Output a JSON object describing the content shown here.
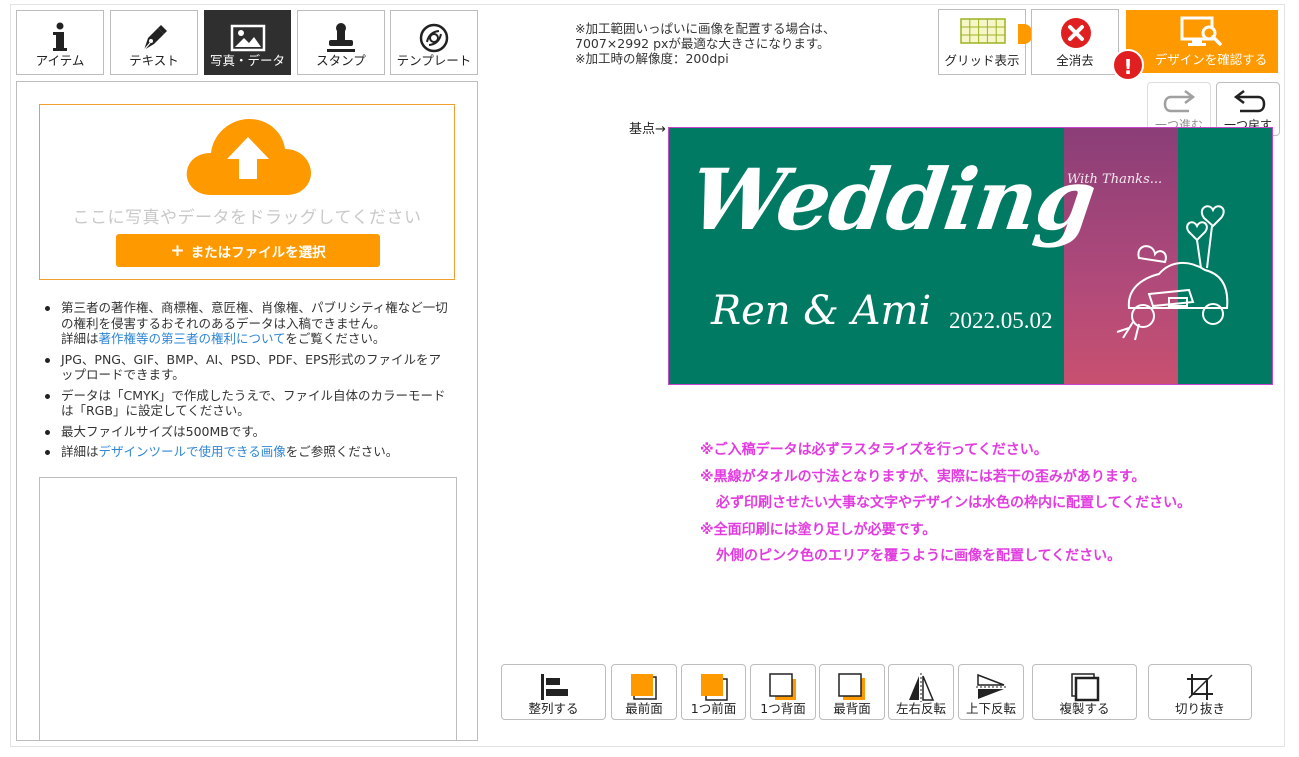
{
  "tabs": [
    {
      "label": "アイテム",
      "icon": "info-icon"
    },
    {
      "label": "テキスト",
      "icon": "pen-icon"
    },
    {
      "label": "写真・データ",
      "icon": "image-icon",
      "active": true
    },
    {
      "label": "スタンプ",
      "icon": "stamp-icon"
    },
    {
      "label": "テンプレート",
      "icon": "template-icon"
    }
  ],
  "upload": {
    "drop_text": "ここに写真やデータをドラッグしてください",
    "button_label": "またはファイルを選択",
    "notes": {
      "n1_text": "第三者の著作権、商標権、意匠権、肖像権、パブリシティ権など一切の権利を侵害するおそれのあるデータは入稿できません。",
      "n1_detail_prefix": "詳細は",
      "n1_link": "著作権等の第三者の権利について",
      "n1_suffix": "をご覧ください。",
      "n2": "JPG、PNG、GIF、BMP、AI、PSD、PDF、EPS形式のファイルをアップロードできます。",
      "n3": "データは「CMYK」で作成したうえで、ファイル自体のカラーモードは「RGB」に設定してください。",
      "n4": "最大ファイルサイズは500MBです。",
      "n5_prefix": "詳細は",
      "n5_link": "デザインツールで使用できる画像",
      "n5_suffix": "をご参照ください。"
    }
  },
  "header": {
    "info_line1": "※加工範囲いっぱいに画像を配置する場合は、",
    "info_line2": "7007×2992 pxが最適な大きさになります。",
    "info_line3": "※加工時の解像度：200dpi",
    "grid_label": "グリッド表示",
    "clear_label": "全消去",
    "confirm_label": "デザインを確認する",
    "alert": "!"
  },
  "history": {
    "redo_label": "一つ進む",
    "undo_label": "一つ戻す"
  },
  "canvas": {
    "origin_label": "基点→",
    "design": {
      "thanks": "With Thanks...",
      "title": "Wedding",
      "names": "Ren & Ami",
      "date": "2022.05.02"
    },
    "colors": {
      "background": "#007a62",
      "band": "#b04a7a",
      "outline": "#c844c8"
    }
  },
  "warnings": [
    "※ご入稿データは必ずラスタライズを行ってください。",
    "※黒線がタオルの寸法となりますが、実際には若干の歪みがあります。",
    "必ず印刷させたい大事な文字やデザインは水色の枠内に配置してください。",
    "※全面印刷には塗り足しが必要です。",
    "外側のピンク色のエリアを覆うように画像を配置してください。"
  ],
  "toolbar": {
    "align": "整列する",
    "front_most": "最前面",
    "forward": "1つ前面",
    "backward": "1つ背面",
    "back_most": "最背面",
    "flip_h": "左右反転",
    "flip_v": "上下反転",
    "duplicate": "複製する",
    "crop": "切り抜き"
  },
  "colors": {
    "accent": "#ff9900",
    "link": "#2f86d6",
    "warning": "#e23be0",
    "alert": "#e02020"
  }
}
